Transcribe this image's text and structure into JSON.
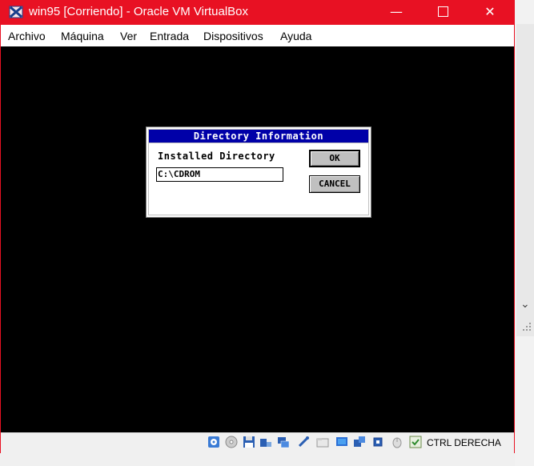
{
  "window": {
    "title": "win95 [Corriendo] - Oracle VM VirtualBox",
    "minimize_glyph": "—",
    "close_glyph": "✕",
    "accent": "#e81123"
  },
  "menu": {
    "items": [
      "Archivo",
      "Máquina",
      "Ver",
      "Entrada",
      "Dispositivos",
      "Ayuda"
    ]
  },
  "dialog": {
    "title": "Directory Information",
    "label": "Installed Directory",
    "input_value": "C:\\CDROM",
    "ok_label": "OK",
    "cancel_label": "CANCEL",
    "title_color": "#0000a8"
  },
  "statusbar": {
    "host_key": "CTRL DERECHA",
    "icons": [
      "hard-disk-icon",
      "optical-drive-icon",
      "floppy-icon",
      "audio-icon",
      "network-icon",
      "usb-icon",
      "shared-folders-icon",
      "display-icon",
      "video-capture-icon",
      "cpu-icon",
      "mouse-integration-icon",
      "host-key-icon"
    ]
  },
  "background": {
    "scroll_glyph": "⌄"
  }
}
